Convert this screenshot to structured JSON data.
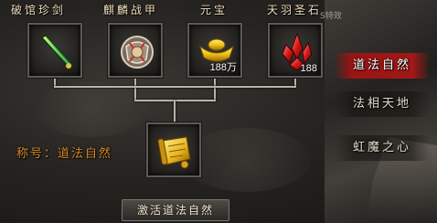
{
  "items": [
    {
      "label": "破馆珍剑",
      "icon": "jade-sword-icon",
      "count": ""
    },
    {
      "label": "麒麟战甲",
      "icon": "qilin-armor-icon",
      "count": ""
    },
    {
      "label": "元宝",
      "icon": "gold-ingot-icon",
      "count": "188万"
    },
    {
      "label": "天羽圣石",
      "icon": "red-crystal-icon",
      "count": "188"
    }
  ],
  "result": {
    "icon": "golden-scroll-icon"
  },
  "title_label": "称号：道法自然",
  "activate_button": "激活道法自然",
  "corner_text": "S特效",
  "side_tabs": [
    {
      "label": "道法自然",
      "active": true
    },
    {
      "label": "法相天地",
      "active": false
    },
    {
      "label": "虹魔之心",
      "active": false
    }
  ],
  "colors": {
    "active_tab": "#9b1414",
    "title_text": "#d88a2c",
    "connector": "#b9b3a8"
  }
}
